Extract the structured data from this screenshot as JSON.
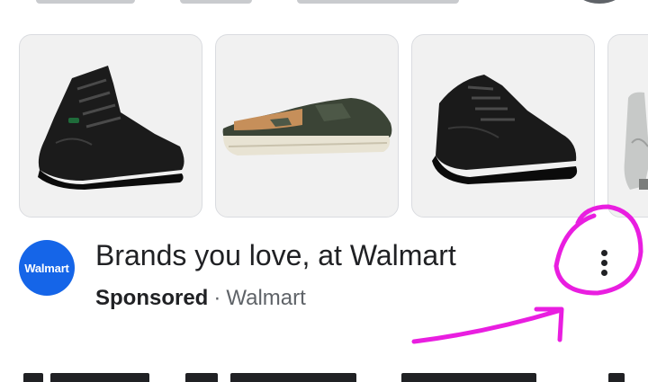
{
  "products": {
    "items": [
      {
        "name": "black-leather-boot"
      },
      {
        "name": "camo-slip-on-shoe"
      },
      {
        "name": "black-leather-sneaker"
      },
      {
        "name": "gray-boot-partial"
      }
    ]
  },
  "ad": {
    "logo_text": "Walmart",
    "headline": "Brands you love, at Walmart",
    "sponsored_label": "Sponsored",
    "separator": "·",
    "advertiser": "Walmart",
    "menu_icon": "more-vert-icon"
  },
  "colors": {
    "brand": "#1565e8",
    "annotation": "#e91ee0",
    "text_primary": "#202124",
    "text_secondary": "#5f6368"
  }
}
